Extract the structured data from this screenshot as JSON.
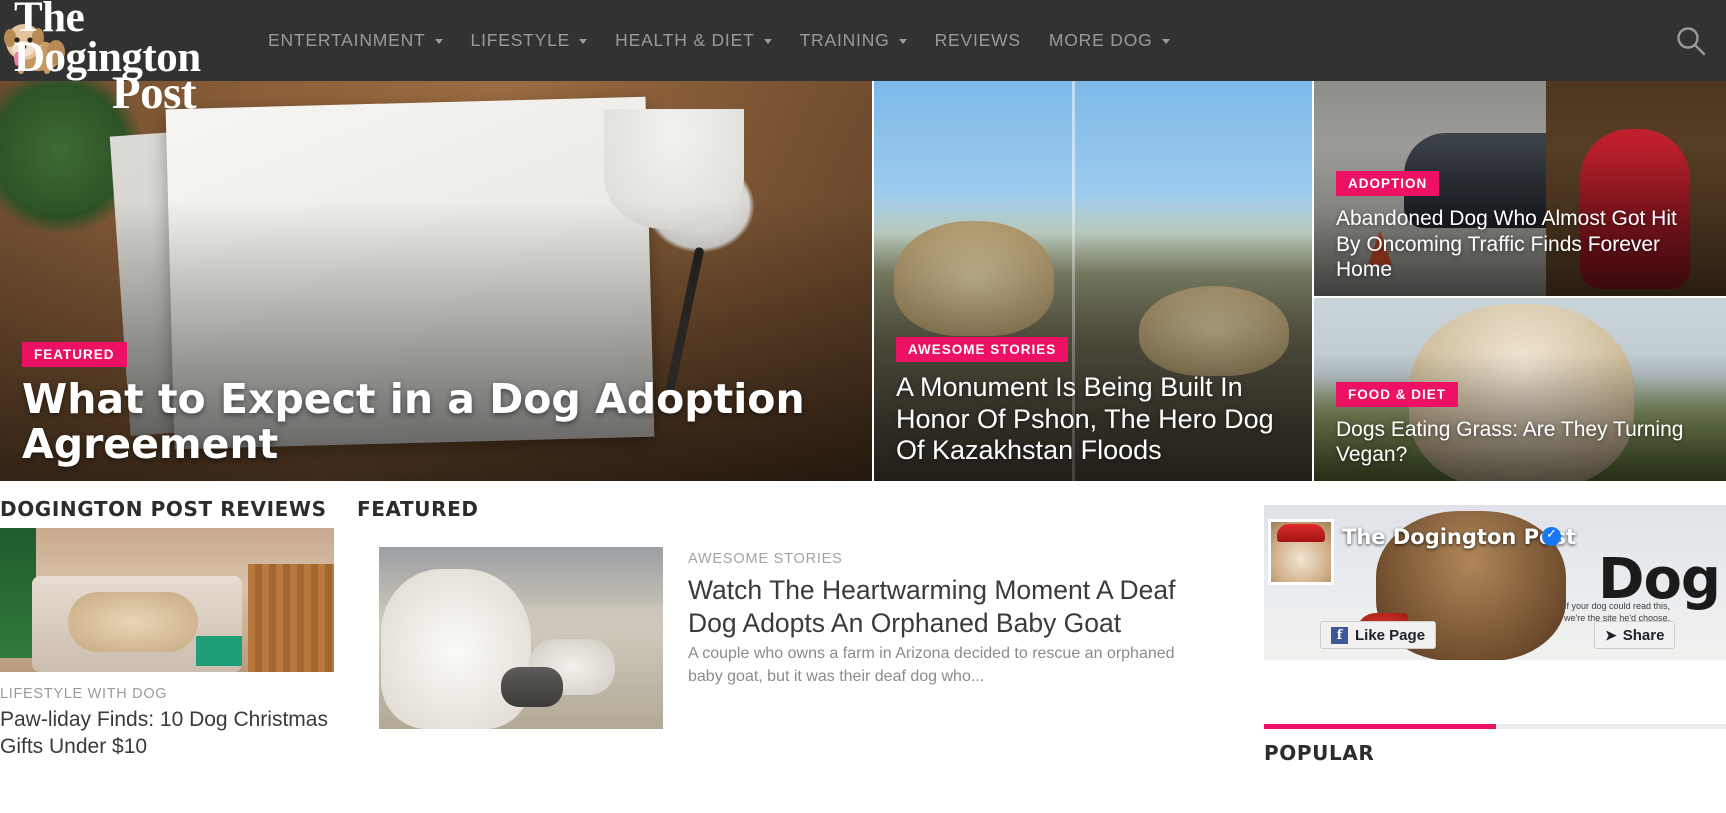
{
  "site": {
    "logo_line1": "The Dogington",
    "logo_line2": "Post",
    "logo_dog_icon": "bulldog-mascot-icon"
  },
  "nav": {
    "items": [
      {
        "label": "ENTERTAINMENT",
        "has_dropdown": true
      },
      {
        "label": "LIFESTYLE",
        "has_dropdown": true
      },
      {
        "label": "HEALTH & DIET",
        "has_dropdown": true
      },
      {
        "label": "TRAINING",
        "has_dropdown": true
      },
      {
        "label": "REVIEWS",
        "has_dropdown": false
      },
      {
        "label": "MORE DOG",
        "has_dropdown": true
      }
    ],
    "search_icon": "search-icon"
  },
  "hero": {
    "main": {
      "badge": "FEATURED",
      "title": "What to Expect in a Dog Adoption Agreement"
    },
    "middle": {
      "badge": "AWESOME STORIES",
      "title": "A Monument Is Being Built In Honor Of Pshon, The Hero Dog Of Kazakhstan Floods"
    },
    "top_right": {
      "badge": "ADOPTION",
      "title": "Abandoned Dog Who Almost Got Hit By Oncoming Traffic Finds Forever Home"
    },
    "bottom_right": {
      "badge": "FOOD & DIET",
      "title": "Dogs Eating Grass: Are They Turning Vegan?"
    }
  },
  "reviews": {
    "heading": "DOGINGTON POST REVIEWS",
    "item": {
      "category": "LIFESTYLE WITH DOG",
      "title": "Paw-liday Finds: 10 Dog Christmas Gifts Under $10"
    }
  },
  "featured": {
    "heading": "FEATURED",
    "item": {
      "category": "AWESOME STORIES",
      "title": "Watch The Heartwarming Moment A Deaf Dog Adopts An Orphaned Baby Goat",
      "excerpt": "A couple who owns a farm in Arizona decided to rescue an orphaned baby goat, but it was their deaf dog who..."
    }
  },
  "sidebar": {
    "facebook": {
      "page_name": "The Dogington Post",
      "verified_icon": "verified-badge-icon",
      "like_label": "Like Page",
      "share_label": "Share",
      "facebook_icon": "facebook-f-icon",
      "share_icon": "share-arrow-icon",
      "cover_word": "Dog",
      "overlay_text": "If your dog could read this, we're the site he'd choose."
    },
    "popular_heading": "POPULAR"
  },
  "colors": {
    "accent_pink": "#ED1164",
    "header_bg": "#323232",
    "nav_text": "#9a9a9a",
    "body_text": "#3a3a3a",
    "muted_text": "#9b9b9b"
  }
}
